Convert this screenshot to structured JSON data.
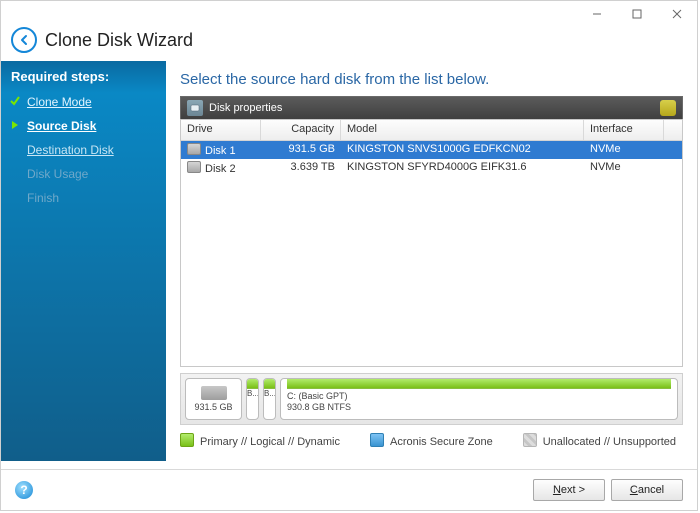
{
  "window": {
    "title": "Clone Disk Wizard"
  },
  "sidebar": {
    "header": "Required steps:",
    "steps": [
      {
        "label": "Clone Mode",
        "state": "done"
      },
      {
        "label": "Source Disk",
        "state": "current"
      },
      {
        "label": "Destination Disk",
        "state": "next"
      },
      {
        "label": "Disk Usage",
        "state": "disabled"
      },
      {
        "label": "Finish",
        "state": "disabled"
      }
    ]
  },
  "main": {
    "instruction": "Select the source hard disk from the list below.",
    "disk_props_label": "Disk properties",
    "columns": {
      "drive": "Drive",
      "capacity": "Capacity",
      "model": "Model",
      "interface": "Interface"
    },
    "rows": [
      {
        "drive": "Disk 1",
        "capacity": "931.5 GB",
        "model": "KINGSTON SNVS1000G EDFKCN02",
        "interface": "NVMe",
        "selected": true
      },
      {
        "drive": "Disk 2",
        "capacity": "3.639 TB",
        "model": "KINGSTON SFYRD4000G EIFK31.6",
        "interface": "NVMe",
        "selected": false
      }
    ],
    "partmap": {
      "disk_size": "931.5 GB",
      "seg_labels": {
        "s1": "B...",
        "s2": "B..."
      },
      "c_label": "C: (Basic GPT)",
      "c_size": "930.8 GB  NTFS"
    },
    "legend": {
      "primary": "Primary // Logical // Dynamic",
      "secure": "Acronis Secure Zone",
      "unalloc": "Unallocated // Unsupported"
    }
  },
  "footer": {
    "next": "Next >",
    "cancel": "Cancel",
    "next_underline": "N",
    "cancel_underline": "C"
  }
}
